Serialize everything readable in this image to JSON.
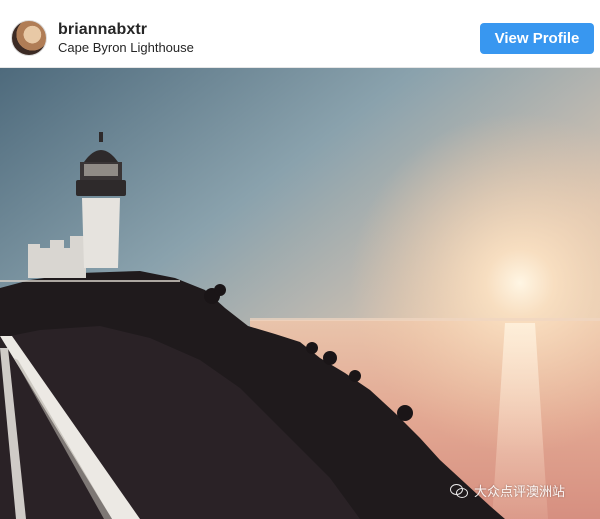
{
  "post_header": {
    "username": "briannabxtr",
    "location": "Cape Byron Lighthouse",
    "view_profile_label": "View Profile"
  },
  "photo": {
    "subject": "lighthouse-on-cliff-at-sunrise"
  },
  "watermark": {
    "text": "大众点评澳洲站",
    "icon": "wechat-icon"
  },
  "colors": {
    "button": "#3897f0",
    "username": "#262626"
  }
}
